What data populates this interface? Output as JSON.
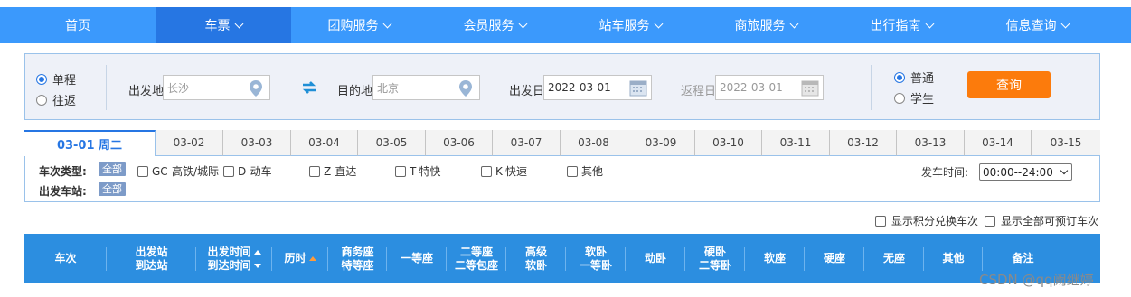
{
  "nav": {
    "items": [
      {
        "label": "首页",
        "dropdown": false,
        "active": false
      },
      {
        "label": "车票",
        "dropdown": true,
        "active": true
      },
      {
        "label": "团购服务",
        "dropdown": true,
        "active": false
      },
      {
        "label": "会员服务",
        "dropdown": true,
        "active": false
      },
      {
        "label": "站车服务",
        "dropdown": true,
        "active": false
      },
      {
        "label": "商旅服务",
        "dropdown": true,
        "active": false
      },
      {
        "label": "出行指南",
        "dropdown": true,
        "active": false
      },
      {
        "label": "信息查询",
        "dropdown": true,
        "active": false
      }
    ]
  },
  "search": {
    "trip_type": {
      "one_way": "单程",
      "round_trip": "往返",
      "selected": "单程"
    },
    "from": {
      "label": "出发地",
      "placeholder": "长沙"
    },
    "to": {
      "label": "目的地",
      "placeholder": "北京"
    },
    "depart_date": {
      "label": "出发日",
      "value": "2022-03-01"
    },
    "return_date": {
      "label": "返程日",
      "value": "2022-03-01"
    },
    "ticket_type": {
      "normal": "普通",
      "student": "学生",
      "selected": "普通"
    },
    "query_label": "查询"
  },
  "date_tabs": [
    "03-01 周二",
    "03-02",
    "03-03",
    "03-04",
    "03-05",
    "03-06",
    "03-07",
    "03-08",
    "03-09",
    "03-10",
    "03-11",
    "03-12",
    "03-13",
    "03-14",
    "03-15"
  ],
  "filters": {
    "train_type_label": "车次类型:",
    "depart_station_label": "出发车站:",
    "all_tag": "全部",
    "types": [
      "GC-高铁/城际",
      "D-动车",
      "Z-直达",
      "T-特快",
      "K-快速",
      "其他"
    ],
    "depart_time_label": "发车时间:",
    "depart_time_value": "00:00--24:00"
  },
  "options": {
    "points_exchange": "显示积分兑换车次",
    "all_bookable": "显示全部可预订车次"
  },
  "table_header": {
    "train_no": "车次",
    "stations": [
      "出发站",
      "到达站"
    ],
    "times": [
      "出发时间",
      "到达时间"
    ],
    "duration": "历时",
    "business": [
      "商务座",
      "特等座"
    ],
    "first": "一等座",
    "second": [
      "二等座",
      "二等包座"
    ],
    "premium_sleeper": [
      "高级",
      "软卧"
    ],
    "soft_sleeper": [
      "软卧",
      "一等卧"
    ],
    "moving_sleeper": "动卧",
    "hard_sleeper": [
      "硬卧",
      "二等卧"
    ],
    "soft_seat": "软座",
    "hard_seat": "硬座",
    "no_seat": "无座",
    "other": "其他",
    "remarks": "备注"
  },
  "watermark": "CSDN @qq阙继婷",
  "colors": {
    "nav_bg": "#3b99fc",
    "nav_active": "#2676e3",
    "query_btn": "#fc7b0c",
    "table_header": "#2c8ee0"
  }
}
